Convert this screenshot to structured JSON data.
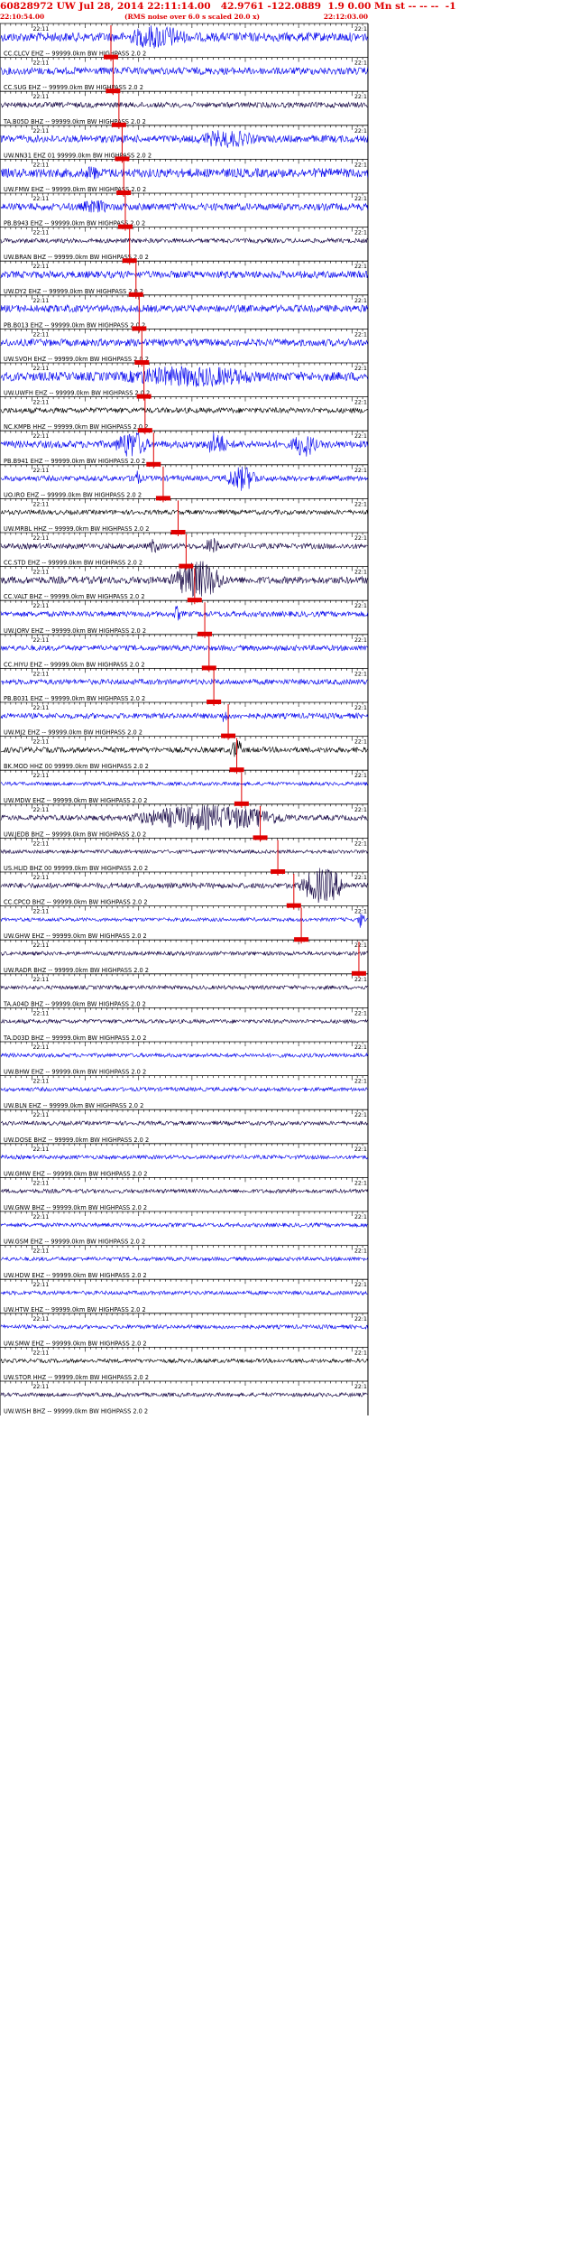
{
  "header": {
    "title": "60828972 UW Jul 28, 2014 22:11:14.00   42.9761 -122.0889  1.9 0.00 Mn st -- -- --  -1",
    "start_time": "22:10:54.00",
    "note": "(RMS noise over 6.0 s scaled 20.0 x)",
    "end_time": "22:12:03.00"
  },
  "tick_label": "22:11",
  "tick_label_right": "22:1",
  "colors": {
    "header_text": "#e00000",
    "pick": "#e00000",
    "trace_blue": "#0000ee",
    "trace_dark": "#100040",
    "trace_black": "#000000",
    "axis": "#000000"
  },
  "traces": [
    {
      "label": "CC.CLCV EHZ -- 99999.0km BW  HIGHPASS  2.0  2",
      "color": "blue"
    },
    {
      "label": "CC.SUG EHZ -- 99999.0km BW  HIGHPASS  2.0  2",
      "color": "blue"
    },
    {
      "label": "TA.B05D BHZ -- 99999.0km BW  HIGHPASS  2.0  2",
      "color": "dark"
    },
    {
      "label": "UW.NN31 EHZ 01 99999.0km BW  HIGHPASS  2.0  2",
      "color": "blue"
    },
    {
      "label": "UW.FMW EHZ -- 99999.0km BW  HIGHPASS  2.0  2",
      "color": "blue"
    },
    {
      "label": "PB.B943 EHZ -- 99999.0km BW  HIGHPASS  2.0  2",
      "color": "blue"
    },
    {
      "label": "UW.BRAN BHZ -- 99999.0km BW  HIGHPASS  2.0  2",
      "color": "dark"
    },
    {
      "label": "UW.DY2 EHZ -- 99999.0km BW  HIGHPASS  2.0  2",
      "color": "blue"
    },
    {
      "label": "PB.B013 EHZ -- 99999.0km BW  HIGHPASS  2.0  2",
      "color": "blue"
    },
    {
      "label": "UW.SVOH EHZ -- 99999.0km BW  HIGHPASS  2.0  2",
      "color": "blue"
    },
    {
      "label": "UW.UWFH EHZ -- 99999.0km BW  HIGHPASS  2.0  2",
      "color": "blue"
    },
    {
      "label": "NC.KMPB HHZ -- 99999.0km BW  HIGHPASS  2.0  2",
      "color": "black"
    },
    {
      "label": "PB.B941 EHZ -- 99999.0km BW  HIGHPASS  2.0  2",
      "color": "blue"
    },
    {
      "label": "UO.IRO EHZ -- 99999.0km BW  HIGHPASS  2.0  2",
      "color": "blue"
    },
    {
      "label": "UW.MRBL HHZ -- 99999.0km BW  HIGHPASS  2.0  2",
      "color": "black"
    },
    {
      "label": "CC.STD EHZ -- 99999.0km BW  HIGHPASS  2.0  2",
      "color": "dark"
    },
    {
      "label": "CC.VALT BHZ -- 99999.0km BW  HIGHPASS  2.0  2",
      "color": "dark"
    },
    {
      "label": "UW.JORV EHZ -- 99999.0km BW  HIGHPASS  2.0  2",
      "color": "blue"
    },
    {
      "label": "CC.HIYU EHZ -- 99999.0km BW  HIGHPASS  2.0  2",
      "color": "blue"
    },
    {
      "label": "PB.B031 EHZ -- 99999.0km BW  HIGHPASS  2.0  2",
      "color": "blue"
    },
    {
      "label": "UW.MJ2 EHZ -- 99999.0km BW  HIGHPASS  2.0  2",
      "color": "blue"
    },
    {
      "label": "BK.MOD HHZ 00 99999.0km BW  HIGHPASS  2.0  2",
      "color": "black"
    },
    {
      "label": "UW.MDW EHZ -- 99999.0km BW  HIGHPASS  2.0  2",
      "color": "blue"
    },
    {
      "label": "UW.JEDB BHZ -- 99999.0km BW  HIGHPASS  2.0  2",
      "color": "dark"
    },
    {
      "label": "US.HLID BHZ 00 99999.0km BW  HIGHPASS  2.0  2",
      "color": "dark"
    },
    {
      "label": "CC.CPCO BHZ -- 99999.0km BW  HIGHPASS  2.0  2",
      "color": "dark"
    },
    {
      "label": "UW.GHW EHZ -- 99999.0km BW  HIGHPASS  2.0  2",
      "color": "blue"
    },
    {
      "label": "UW.RADR BHZ -- 99999.0km BW  HIGHPASS  2.0  2",
      "color": "dark"
    },
    {
      "label": "TA.A04D BHZ -- 99999.0km BW  HIGHPASS  2.0  2",
      "color": "dark"
    },
    {
      "label": "TA.D03D BHZ -- 99999.0km BW  HIGHPASS  2.0  2",
      "color": "dark"
    },
    {
      "label": "UW.BHW EHZ -- 99999.0km BW  HIGHPASS  2.0  2",
      "color": "blue"
    },
    {
      "label": "UW.BLN EHZ -- 99999.0km BW  HIGHPASS  2.0  2",
      "color": "blue"
    },
    {
      "label": "UW.DOSE BHZ -- 99999.0km BW  HIGHPASS  2.0  2",
      "color": "dark"
    },
    {
      "label": "UW.GMW EHZ -- 99999.0km BW  HIGHPASS  2.0  2",
      "color": "blue"
    },
    {
      "label": "UW.GNW BHZ -- 99999.0km BW  HIGHPASS  2.0  2",
      "color": "dark"
    },
    {
      "label": "UW.GSM EHZ -- 99999.0km BW  HIGHPASS  2.0  2",
      "color": "blue"
    },
    {
      "label": "UW.HDW EHZ -- 99999.0km BW  HIGHPASS  2.0  2",
      "color": "blue"
    },
    {
      "label": "UW.HTW EHZ -- 99999.0km BW  HIGHPASS  2.0  2",
      "color": "blue"
    },
    {
      "label": "UW.SMW EHZ -- 99999.0km BW  HIGHPASS  2.0  2",
      "color": "blue"
    },
    {
      "label": "UW.STOR HHZ -- 99999.0km BW  HIGHPASS  2.0  2",
      "color": "black"
    },
    {
      "label": "UW.WISH BHZ -- 99999.0km BW  HIGHPASS  2.0  2",
      "color": "dark"
    }
  ],
  "picks": [
    {
      "row": 1,
      "time_s": 20.8
    },
    {
      "row": 2,
      "time_s": 21.2
    },
    {
      "row": 3,
      "time_s": 22.3
    },
    {
      "row": 4,
      "time_s": 22.9
    },
    {
      "row": 5,
      "time_s": 23.2
    },
    {
      "row": 6,
      "time_s": 23.5
    },
    {
      "row": 7,
      "time_s": 24.3
    },
    {
      "row": 8,
      "time_s": 25.5
    },
    {
      "row": 9,
      "time_s": 26.1
    },
    {
      "row": 10,
      "time_s": 26.6
    },
    {
      "row": 11,
      "time_s": 27.0
    },
    {
      "row": 12,
      "time_s": 27.2
    },
    {
      "row": 13,
      "time_s": 28.8
    },
    {
      "row": 14,
      "time_s": 30.6
    },
    {
      "row": 15,
      "time_s": 33.4
    },
    {
      "row": 16,
      "time_s": 34.9
    },
    {
      "row": 17,
      "time_s": 36.5
    },
    {
      "row": 18,
      "time_s": 38.4
    },
    {
      "row": 19,
      "time_s": 39.2
    },
    {
      "row": 20,
      "time_s": 40.1
    },
    {
      "row": 21,
      "time_s": 42.8
    },
    {
      "row": 22,
      "time_s": 44.4
    },
    {
      "row": 23,
      "time_s": 45.3
    },
    {
      "row": 24,
      "time_s": 48.8
    },
    {
      "row": 25,
      "time_s": 52.1
    },
    {
      "row": 26,
      "time_s": 55.1
    },
    {
      "row": 27,
      "time_s": 56.5
    },
    {
      "row": 28,
      "time_s": 67.3
    }
  ]
}
